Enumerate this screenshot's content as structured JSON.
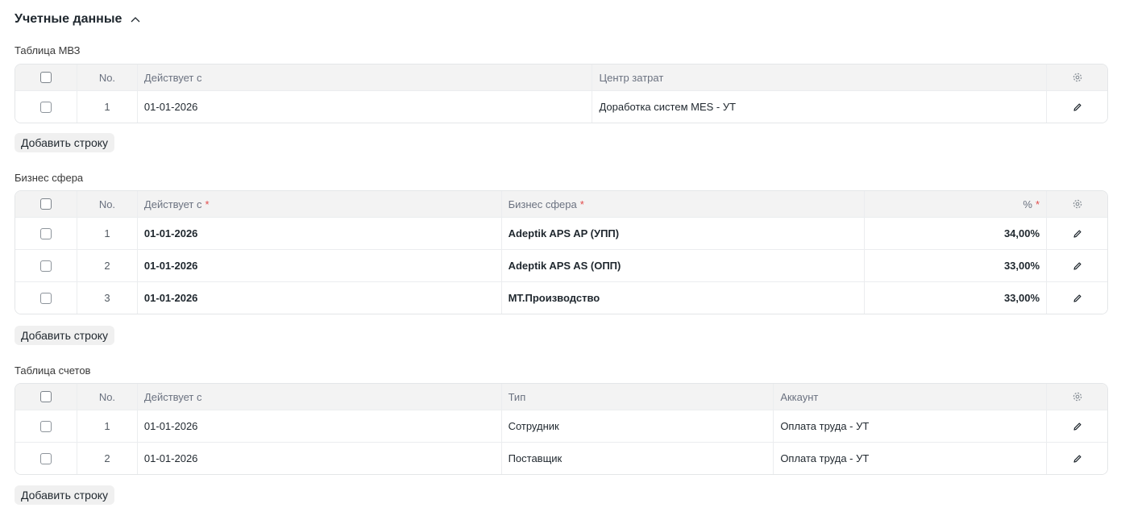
{
  "section": {
    "title": "Учетные данные",
    "collapse_icon": "chevron-up-icon"
  },
  "mvz": {
    "label": "Таблица МВЗ",
    "headers": {
      "no": "No.",
      "valid_from": "Действует с",
      "cost_center": "Центр затрат"
    },
    "rows": [
      {
        "no": "1",
        "valid_from": "01-01-2026",
        "cost_center": "Доработка систем MES - УТ"
      }
    ],
    "add_row": "Добавить строку"
  },
  "business": {
    "label": "Бизнес сфера",
    "headers": {
      "no": "No.",
      "valid_from": "Действует с",
      "sphere": "Бизнес сфера",
      "percent": "%",
      "required_mark": "*"
    },
    "rows": [
      {
        "no": "1",
        "valid_from": "01-01-2026",
        "sphere": "Adeptik APS AP (УПП)",
        "percent": "34,00%"
      },
      {
        "no": "2",
        "valid_from": "01-01-2026",
        "sphere": "Adeptik APS AS (ОПП)",
        "percent": "33,00%"
      },
      {
        "no": "3",
        "valid_from": "01-01-2026",
        "sphere": "MT.Производство",
        "percent": "33,00%"
      }
    ],
    "add_row": "Добавить строку"
  },
  "accounts": {
    "label": "Таблица счетов",
    "headers": {
      "no": "No.",
      "valid_from": "Действует с",
      "type": "Тип",
      "account": "Аккаунт"
    },
    "rows": [
      {
        "no": "1",
        "valid_from": "01-01-2026",
        "type": "Сотрудник",
        "account": "Оплата труда - УТ"
      },
      {
        "no": "2",
        "valid_from": "01-01-2026",
        "type": "Поставщик",
        "account": "Оплата труда - УТ"
      }
    ],
    "add_row": "Добавить строку"
  },
  "icons": {
    "settings": "gear-icon",
    "edit": "pencil-icon"
  }
}
